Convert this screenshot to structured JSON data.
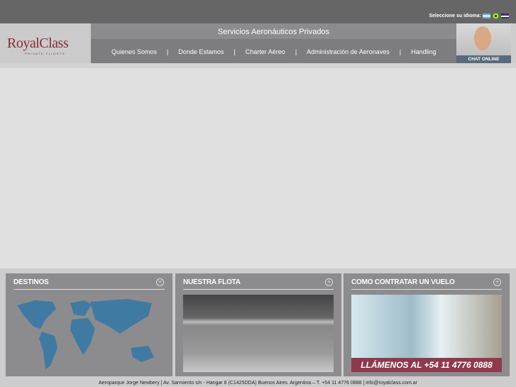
{
  "lang": {
    "label": "Seleccione su idioma:",
    "flags": [
      "flag-argentina",
      "flag-brazil",
      "flag-uk"
    ]
  },
  "logo": {
    "name": "RoyalClass",
    "tagline": "PRIVATE FLIGHTS"
  },
  "header": {
    "title": "Servicios Aeronáuticos Privados"
  },
  "nav": [
    {
      "label": "Quienes Somos"
    },
    {
      "label": "Donde Estamos"
    },
    {
      "label": "Charter Aéreo"
    },
    {
      "label": "Administración de Aeronaves"
    },
    {
      "label": "Handling"
    }
  ],
  "nav_sep": "|",
  "chat": {
    "label": "CHAT ONLINE"
  },
  "panels": [
    {
      "title": "DESTINOS"
    },
    {
      "title": "NUESTRA FLOTA"
    },
    {
      "title": "COMO CONTRATAR UN VUELO",
      "cta": "LLÁMENOS AL +54 11 4776 0888"
    }
  ],
  "plus": "+",
  "footer": "Aeroparque Jorge Newbery | Av. Sarmiento s/n - Hangar 8 (C1425DDA) Buenos Aires. Argentina – T. +54 11 4776 0888 | info@royalclass.com.ar"
}
